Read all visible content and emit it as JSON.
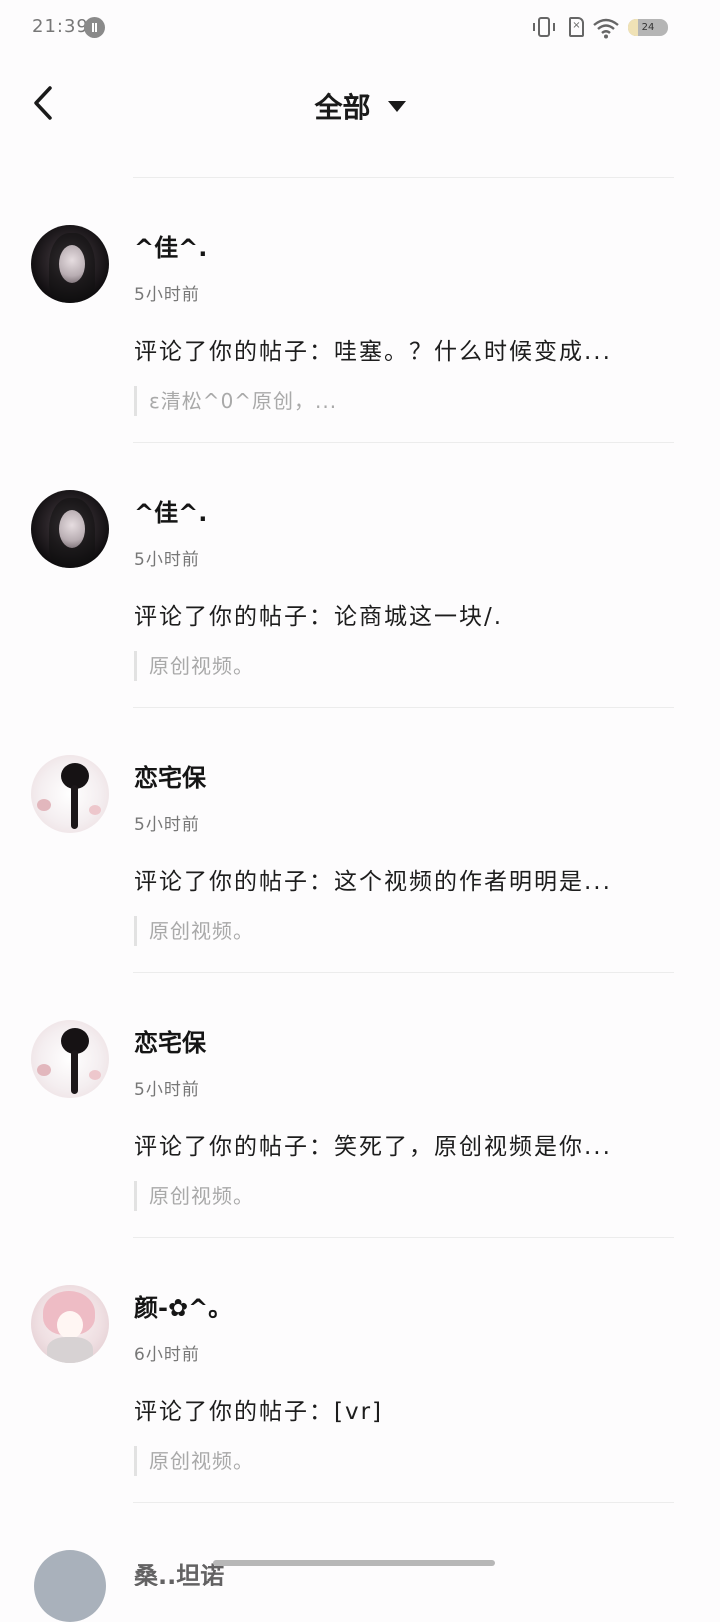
{
  "status_bar": {
    "time": "21:39",
    "battery": "24",
    "battery_level_pct": 24,
    "icons": [
      "notification-app-icon",
      "vibrate-icon",
      "no-sim-icon",
      "wifi-icon",
      "battery-icon"
    ]
  },
  "header": {
    "title": "全部",
    "back_icon": "chevron-left-icon",
    "dropdown_icon": "caret-down-icon"
  },
  "notifications": [
    {
      "name": "^佳^.",
      "time": "5小时前",
      "comment": "评论了你的帖子：哇塞。？什么时候变成...",
      "quote": "ε清松^0^原创，..."
    },
    {
      "name": "^佳^.",
      "time": "5小时前",
      "comment": "评论了你的帖子：论商城这一块/.",
      "quote": "原创视频。"
    },
    {
      "name": "恋宅保",
      "time": "5小时前",
      "comment": "评论了你的帖子：这个视频的作者明明是...",
      "quote": "原创视频。"
    },
    {
      "name": "恋宅保",
      "time": "5小时前",
      "comment": "评论了你的帖子：笑死了，原创视频是你...",
      "quote": "原创视频。"
    },
    {
      "name": "颜-✿^。",
      "time": "6小时前",
      "comment": "评论了你的帖子：[vr]",
      "quote": "原创视频。"
    }
  ],
  "partial_item": {
    "name": "桑..坦诺"
  },
  "colors": {
    "background": "#fdfcfd",
    "text": "#1a1a1a",
    "secondary": "#777777",
    "quote": "#a9a9a9",
    "divider": "#ececec"
  }
}
